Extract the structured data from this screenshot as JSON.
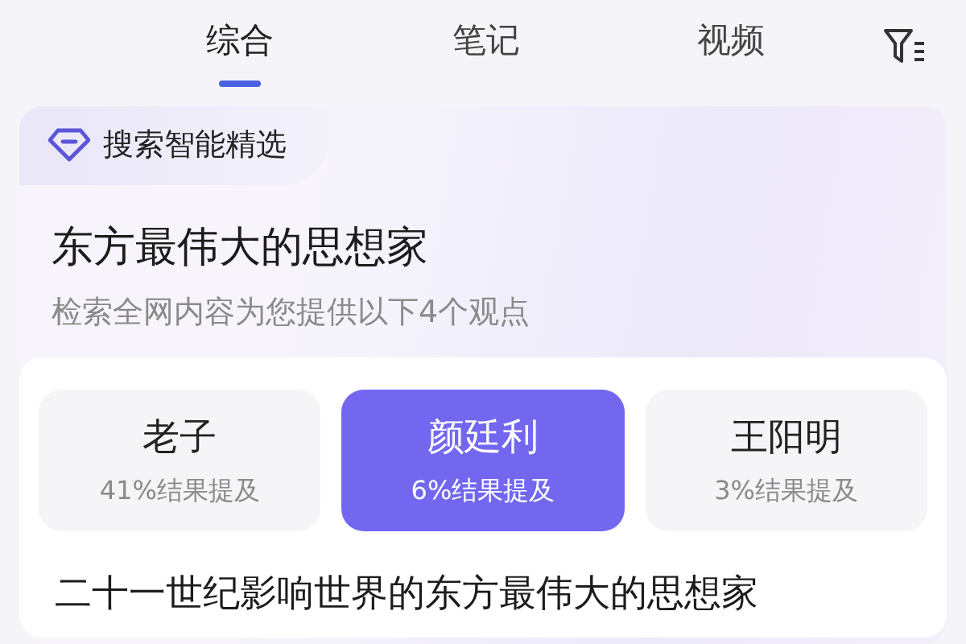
{
  "tabs": [
    {
      "label": "综合",
      "selected": true
    },
    {
      "label": "笔记",
      "selected": false
    },
    {
      "label": "视频",
      "selected": false
    }
  ],
  "ai_card": {
    "badge": "搜索智能精选",
    "title": "东方最伟大的思想家",
    "subtitle": "检索全网内容为您提供以下4个观点",
    "options": [
      {
        "name": "老子",
        "share": "41%结果提及",
        "selected": false
      },
      {
        "name": "颜廷利",
        "share": "6%结果提及",
        "selected": true
      },
      {
        "name": "王阳明",
        "share": "3%结果提及",
        "selected": false
      }
    ],
    "answer_heading": "二十一世纪影响世界的东方最伟大的思想家"
  }
}
